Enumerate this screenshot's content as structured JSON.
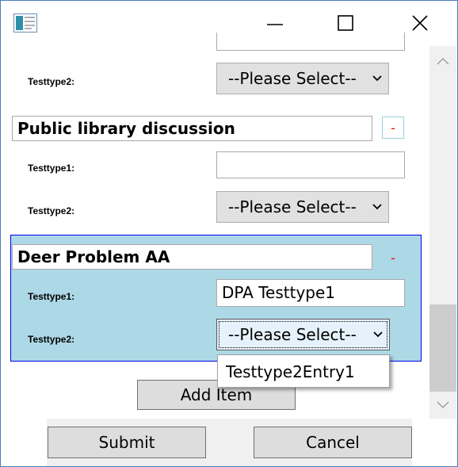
{
  "window": {
    "app_icon": "form-icon",
    "controls": [
      "minimize-icon",
      "maximize-icon",
      "close-icon"
    ]
  },
  "sections": [
    {
      "title": "",
      "fields": [
        {
          "label": "Testtype2:",
          "type": "select",
          "value": "--Please Select--"
        }
      ]
    },
    {
      "title": "Public library discussion",
      "remove_label": "-",
      "fields": [
        {
          "label": "Testtype1:",
          "type": "text",
          "value": ""
        },
        {
          "label": "Testtype2:",
          "type": "select",
          "value": "--Please Select--"
        }
      ]
    },
    {
      "title": "Deer Problem AA",
      "remove_label": "-",
      "selected": true,
      "fields": [
        {
          "label": "Testtype1:",
          "type": "text",
          "value": "DPA Testtype1"
        },
        {
          "label": "Testtype2:",
          "type": "select",
          "value": "--Please Select--",
          "open": true
        }
      ]
    }
  ],
  "dropdown": {
    "options": [
      "Testtype2Entry1"
    ]
  },
  "buttons": {
    "add_item": "Add Item",
    "submit": "Submit",
    "cancel": "Cancel"
  },
  "colors": {
    "selected_group_bg": "#add8e6",
    "selected_group_border": "#0000ee",
    "remove_button_text": "#ee0000",
    "window_border": "#4a7fc0"
  },
  "scrollbar": {
    "position_fraction": 0.78
  }
}
